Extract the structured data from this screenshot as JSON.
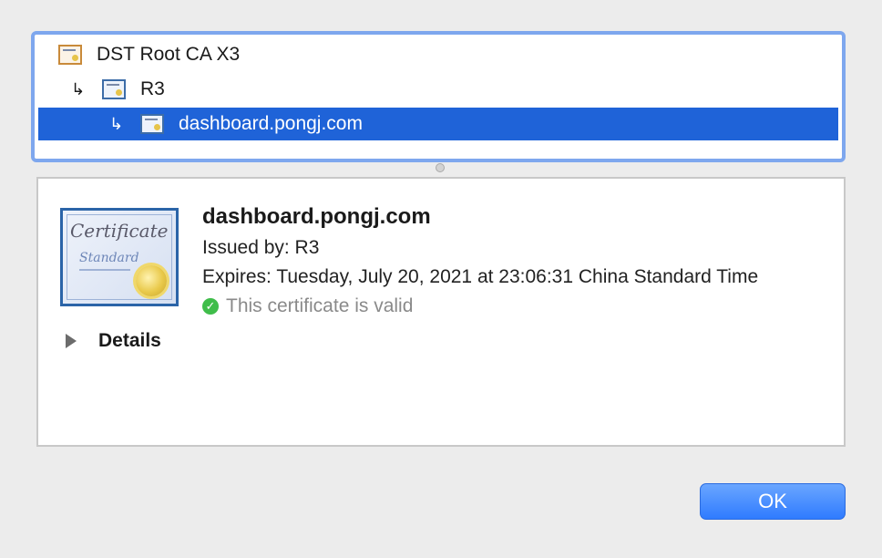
{
  "chain": {
    "items": [
      {
        "label": "DST Root CA X3",
        "icon": "root-certificate-icon",
        "arrow": ""
      },
      {
        "label": "R3",
        "icon": "intermediate-certificate-icon",
        "arrow": "↳"
      },
      {
        "label": "dashboard.pongj.com",
        "icon": "leaf-certificate-icon",
        "arrow": "↳"
      }
    ],
    "selected_index": 2
  },
  "certificate": {
    "icon_script_title": "Certificate",
    "icon_script_subtitle": "Standard",
    "name": "dashboard.pongj.com",
    "issued_by": "Issued by: R3",
    "expires": "Expires: Tuesday, July 20, 2021 at 23:06:31 China Standard Time",
    "status": "This certificate is valid",
    "status_icon": "check-circle-icon",
    "status_color": "#3fbd4a"
  },
  "details": {
    "label": "Details"
  },
  "footer": {
    "ok_label": "OK"
  },
  "colors": {
    "selection": "#1f63d8",
    "focus_ring": "#7ea7ee",
    "button": "#2f7bff"
  }
}
